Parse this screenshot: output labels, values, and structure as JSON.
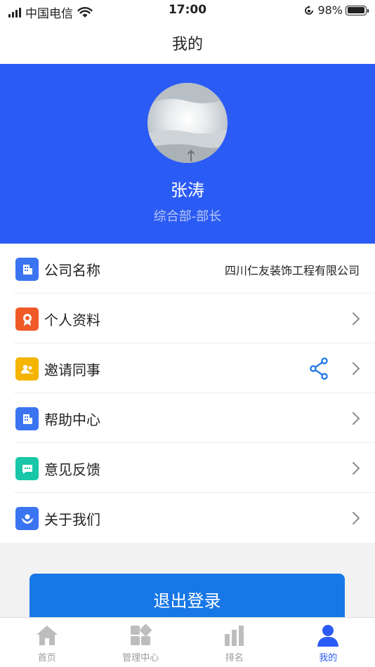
{
  "status_bar": {
    "carrier": "中国电信",
    "time": "17:00",
    "battery": "98%",
    "battery_level": 0.98
  },
  "nav": {
    "title": "我的"
  },
  "profile": {
    "name": "张涛",
    "title": "综合部-部长"
  },
  "menu": {
    "items": [
      {
        "label": "公司名称",
        "value": "四川仁友装饰工程有限公司",
        "icon": "building-icon",
        "color": "#3a74f0"
      },
      {
        "label": "个人资料",
        "icon": "badge-icon",
        "color": "#f05a28"
      },
      {
        "label": "邀请同事",
        "icon": "people-icon",
        "color": "#f4b400"
      },
      {
        "label": "帮助中心",
        "icon": "building-icon",
        "color": "#3a74f0"
      },
      {
        "label": "意见反馈",
        "icon": "message-icon",
        "color": "#17c7a8"
      },
      {
        "label": "关于我们",
        "icon": "hands-icon",
        "color": "#3a74f0"
      }
    ]
  },
  "logout": {
    "label": "退出登录"
  },
  "tabs": [
    {
      "label": "首页",
      "icon": "home-icon"
    },
    {
      "label": "管理中心",
      "icon": "grid-icon"
    },
    {
      "label": "排名",
      "icon": "bar-chart-icon"
    },
    {
      "label": "我的",
      "icon": "person-icon",
      "active": true
    }
  ],
  "colors": {
    "brand_blue": "#2b5bf5",
    "button_blue": "#1877e6",
    "share_blue": "#1a73e8"
  }
}
